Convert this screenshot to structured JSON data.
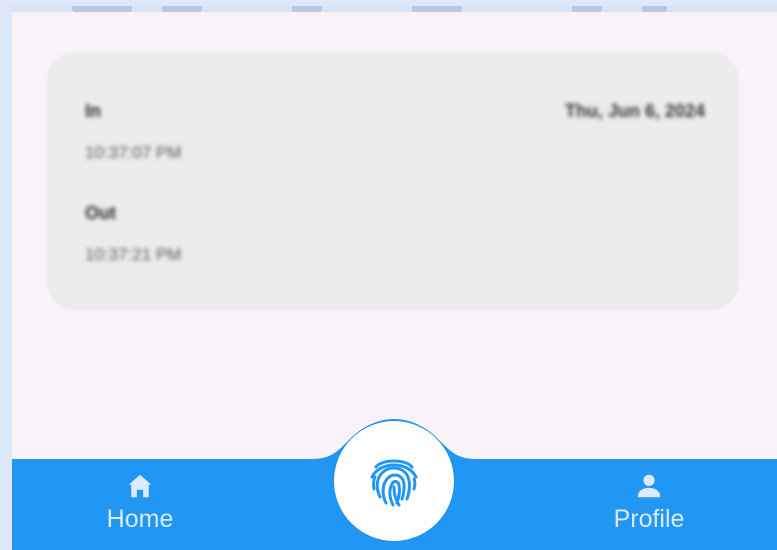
{
  "record": {
    "in_label": "In",
    "in_time": "10:37:07 PM",
    "out_label": "Out",
    "out_time": "10:37:21 PM",
    "date": "Thu, Jun 6, 2024"
  },
  "bottom_nav": {
    "home_label": "Home",
    "profile_label": "Profile",
    "home_icon": "home-icon",
    "profile_icon": "person-icon",
    "center_icon": "fingerprint-icon"
  },
  "colors": {
    "nav_blue": "#2196f3",
    "screen_bg": "#f9f2f9",
    "card_bg": "#ececec"
  }
}
